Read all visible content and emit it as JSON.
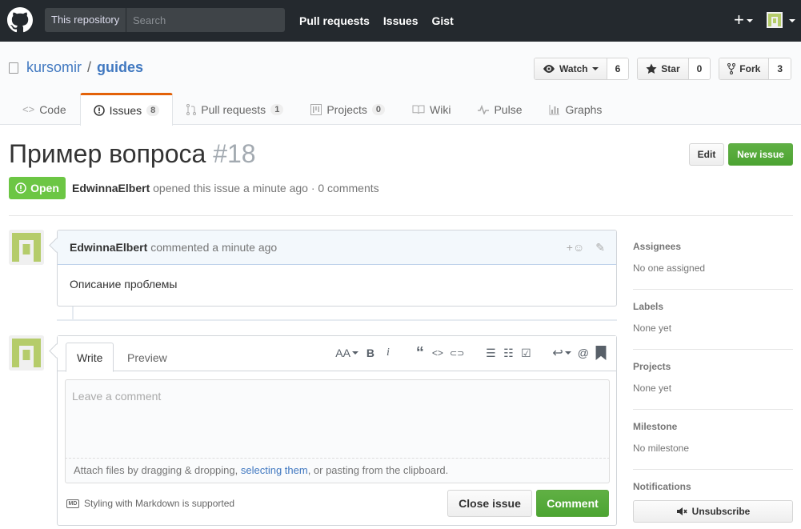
{
  "header": {
    "scope_label": "This repository",
    "search_placeholder": "Search",
    "nav": [
      "Pull requests",
      "Issues",
      "Gist"
    ],
    "plus_label": "+"
  },
  "repo": {
    "owner": "kursomir",
    "slash": "/",
    "name": "guides",
    "watch_label": "Watch",
    "watch_count": "6",
    "star_label": "Star",
    "star_count": "0",
    "fork_label": "Fork",
    "fork_count": "3"
  },
  "tabs": [
    {
      "label": "Code",
      "icon": "code-icon"
    },
    {
      "label": "Issues",
      "count": "8",
      "icon": "issue-opened-icon"
    },
    {
      "label": "Pull requests",
      "count": "1",
      "icon": "git-pull-request-icon"
    },
    {
      "label": "Projects",
      "count": "0",
      "icon": "project-icon"
    },
    {
      "label": "Wiki",
      "icon": "book-icon"
    },
    {
      "label": "Pulse",
      "icon": "pulse-icon"
    },
    {
      "label": "Graphs",
      "icon": "graph-icon"
    }
  ],
  "issue": {
    "title": "Пример вопроса",
    "number": "#18",
    "edit_label": "Edit",
    "new_issue_label": "New issue",
    "state": "Open",
    "author": "EdwinnaElbert",
    "meta_text": "opened this issue a minute ago · 0 comments"
  },
  "comment": {
    "author": "EdwinnaElbert",
    "meta": "commented a minute ago",
    "body": "Описание проблемы",
    "reaction_icon": "smiley-icon",
    "edit_icon": "pencil-icon"
  },
  "new_comment": {
    "write_tab": "Write",
    "preview_tab": "Preview",
    "placeholder": "Leave a comment",
    "attach_prefix": "Attach files by dragging & dropping, ",
    "attach_link": "selecting them",
    "attach_suffix": ", or pasting from the clipboard.",
    "markdown_note": "Styling with Markdown is supported",
    "markdown_icon": "MD",
    "close_label": "Close issue",
    "comment_label": "Comment",
    "toolbar": {
      "heading": "AA",
      "bold": "B",
      "italic": "i",
      "quote": "“",
      "code": "<>",
      "link": "⊂⊃",
      "ul": "☰",
      "ol": "☷",
      "tasks": "☑",
      "reply": "↩",
      "mention": "@",
      "bookmark": "🔖"
    }
  },
  "sidebar": {
    "assignees_title": "Assignees",
    "assignees_value": "No one assigned",
    "labels_title": "Labels",
    "labels_value": "None yet",
    "projects_title": "Projects",
    "projects_value": "None yet",
    "milestone_title": "Milestone",
    "milestone_value": "No milestone",
    "notifications_title": "Notifications",
    "unsubscribe_label": "Unsubscribe"
  },
  "colors": {
    "header_bg": "#24292e",
    "accent_green": "#6cc644",
    "link_blue": "#4078c0",
    "tab_active_orange": "#e36209",
    "identicon_green": "#b5cc6a"
  }
}
